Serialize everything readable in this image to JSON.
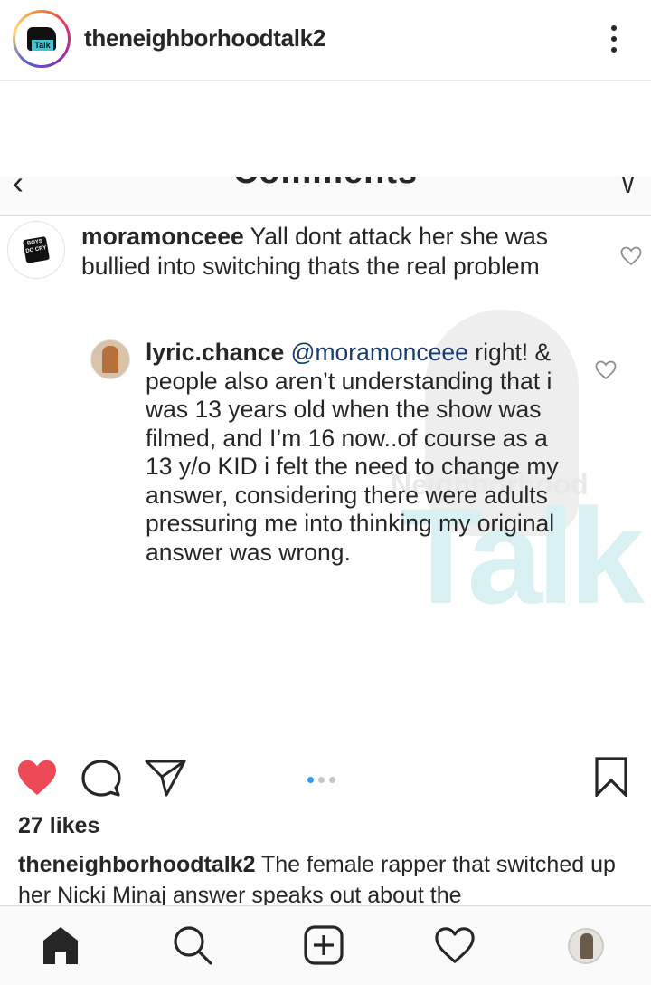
{
  "header": {
    "username": "theneighborhoodtalk2",
    "avatar_logo_text": "Talk"
  },
  "screenshot": {
    "title": "Comments",
    "comments": [
      {
        "username": "moramonceee",
        "text": "Yall dont attack her she was bullied into switching thats the real problem",
        "avatar_badge": "BOYS DO CRY"
      }
    ],
    "replies": [
      {
        "username": "lyric.chance",
        "mention": "@moramonceee",
        "text": "right! & people also aren’t understanding that i was 13 years old when the show was filmed, and I’m 16 now..of course as a 13 y/o KID i felt the need to change my answer, considering there were adults pressuring me into thinking my original answer was wrong."
      }
    ],
    "watermark_line1": "Neighborhood",
    "watermark_line2": "Talk"
  },
  "post": {
    "likes": "27 likes",
    "caption_username": "theneighborhoodtalk2",
    "caption_text": "The female rapper that switched up her Nicki Minaj answer speaks out about the",
    "carousel_count": 3,
    "carousel_active_index": 0,
    "liked": true,
    "colors": {
      "like_red": "#ed4956",
      "carousel_active": "#3897f0",
      "carousel_inactive": "#c7c7c7"
    }
  },
  "icons": {
    "header_more": "more-vertical-icon",
    "like": "heart-filled-icon",
    "comment": "comment-bubble-icon",
    "share": "paper-plane-icon",
    "save": "bookmark-icon",
    "nav": [
      "home-icon",
      "search-icon",
      "add-post-icon",
      "activity-heart-icon",
      "profile-avatar"
    ]
  }
}
